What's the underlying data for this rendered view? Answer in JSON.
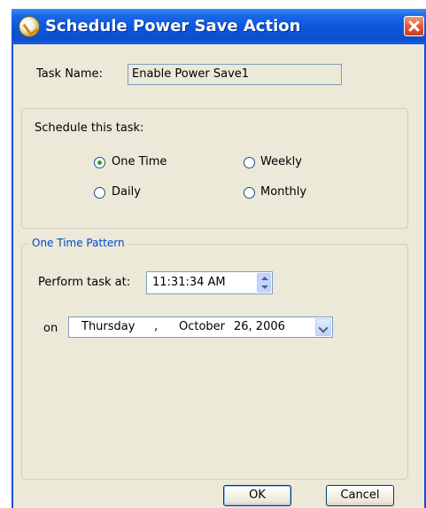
{
  "window": {
    "title": "Schedule Power Save Action"
  },
  "task": {
    "label": "Task Name:",
    "value": "Enable Power Save1"
  },
  "schedule": {
    "label": "Schedule this task:",
    "options": [
      {
        "label": "One Time",
        "selected": true
      },
      {
        "label": "Weekly",
        "selected": false
      },
      {
        "label": "Daily",
        "selected": false
      },
      {
        "label": "Monthly",
        "selected": false
      }
    ]
  },
  "pattern": {
    "title": "One Time Pattern",
    "perform_label": "Perform task at:",
    "time_value": "11:31:34 AM",
    "on_label": "on",
    "date": {
      "weekday": "Thursday",
      "sep": ",",
      "month": "October",
      "day_year": "26, 2006"
    }
  },
  "buttons": {
    "ok": "OK",
    "cancel": "Cancel"
  },
  "colors": {
    "titlebar": "#0b55db",
    "dialog_bg": "#ece9d8",
    "group_title": "#0046d5",
    "radio_dot": "#21a121"
  }
}
